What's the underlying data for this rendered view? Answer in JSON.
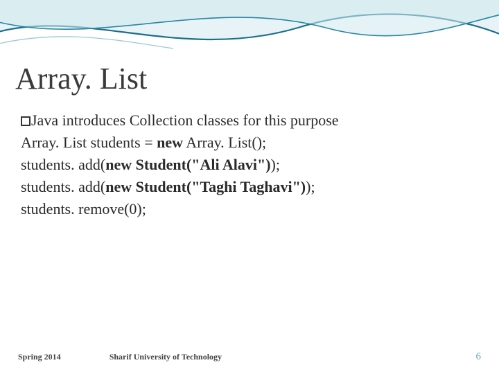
{
  "title": "Array. List",
  "bullet_text": "Java introduces Collection classes for this purpose",
  "code": {
    "l1_a": "Array. List students = ",
    "l1_b": "new",
    "l1_c": " Array. List();",
    "l2_a": "students. add(",
    "l2_b": "new Student(\"Ali Alavi\")",
    "l2_c": ");",
    "l3_a": "students. add(",
    "l3_b": "new Student(\"Taghi Taghavi\")",
    "l3_c": ");",
    "l4": "students. remove(0);"
  },
  "footer": {
    "left": "Spring 2014",
    "center": "Sharif University of Technology",
    "right": "6"
  }
}
